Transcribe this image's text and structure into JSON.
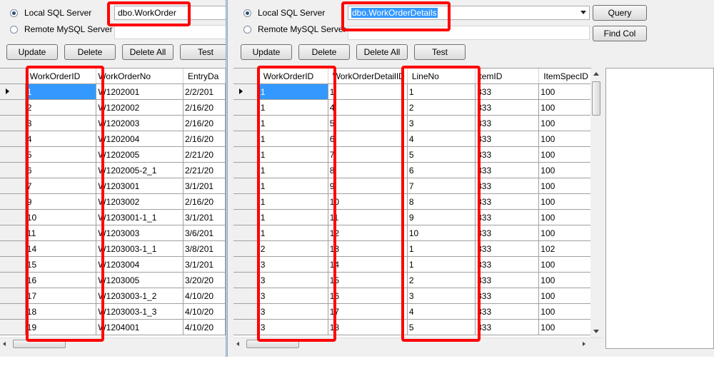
{
  "left_window": {
    "radio_local_label": "Local SQL Server",
    "radio_remote_label": "Remote MySQL Server",
    "table_name_value": "dbo.WorkOrder",
    "buttons": {
      "update": "Update",
      "delete": "Delete",
      "delete_all": "Delete All",
      "test": "Test"
    },
    "columns": [
      "WorkOrderID",
      "WorkOrderNo",
      "EntryDa"
    ],
    "rows": [
      [
        "1",
        "W1202001",
        "2/2/201"
      ],
      [
        "2",
        "W1202002",
        "2/16/20"
      ],
      [
        "3",
        "W1202003",
        "2/16/20"
      ],
      [
        "4",
        "W1202004",
        "2/16/20"
      ],
      [
        "5",
        "W1202005",
        "2/21/20"
      ],
      [
        "6",
        "W1202005-2_1",
        "2/21/20"
      ],
      [
        "7",
        "W1203001",
        "3/1/201"
      ],
      [
        "9",
        "W1203002",
        "2/16/20"
      ],
      [
        "10",
        "W1203001-1_1",
        "3/1/201"
      ],
      [
        "11",
        "W1203003",
        "3/6/201"
      ],
      [
        "14",
        "W1203003-1_1",
        "3/8/201"
      ],
      [
        "15",
        "W1203004",
        "3/1/201"
      ],
      [
        "16",
        "W1203005",
        "3/20/20"
      ],
      [
        "17",
        "W1203003-1_2",
        "4/10/20"
      ],
      [
        "18",
        "W1203003-1_3",
        "4/10/20"
      ],
      [
        "19",
        "W1204001",
        "4/10/20"
      ]
    ]
  },
  "right_window": {
    "radio_local_label": "Local SQL Server",
    "radio_remote_label": "Remote MySQL Server",
    "table_name_value": "dbo.WorkOrderDetails",
    "buttons": {
      "query": "Query",
      "find_col": "Find Col",
      "update": "Update",
      "delete": "Delete",
      "delete_all": "Delete All",
      "test": "Test"
    },
    "columns": [
      "WorkOrderID",
      "WorkOrderDetailID",
      "LineNo",
      "ItemID",
      "ItemSpecID"
    ],
    "rows": [
      [
        "1",
        "1",
        "1",
        "333",
        "100"
      ],
      [
        "1",
        "4",
        "2",
        "333",
        "100"
      ],
      [
        "1",
        "5",
        "3",
        "333",
        "100"
      ],
      [
        "1",
        "6",
        "4",
        "333",
        "100"
      ],
      [
        "1",
        "7",
        "5",
        "333",
        "100"
      ],
      [
        "1",
        "8",
        "6",
        "333",
        "100"
      ],
      [
        "1",
        "9",
        "7",
        "333",
        "100"
      ],
      [
        "1",
        "10",
        "8",
        "333",
        "100"
      ],
      [
        "1",
        "11",
        "9",
        "333",
        "100"
      ],
      [
        "1",
        "12",
        "10",
        "333",
        "100"
      ],
      [
        "2",
        "13",
        "1",
        "333",
        "102"
      ],
      [
        "3",
        "14",
        "1",
        "333",
        "100"
      ],
      [
        "3",
        "15",
        "2",
        "333",
        "100"
      ],
      [
        "3",
        "16",
        "3",
        "333",
        "100"
      ],
      [
        "3",
        "17",
        "4",
        "333",
        "100"
      ],
      [
        "3",
        "18",
        "5",
        "333",
        "100"
      ]
    ]
  },
  "colors": {
    "selection": "#3399ff",
    "highlight_box": "#ff0000",
    "window_bg": "#f0f0f0"
  }
}
